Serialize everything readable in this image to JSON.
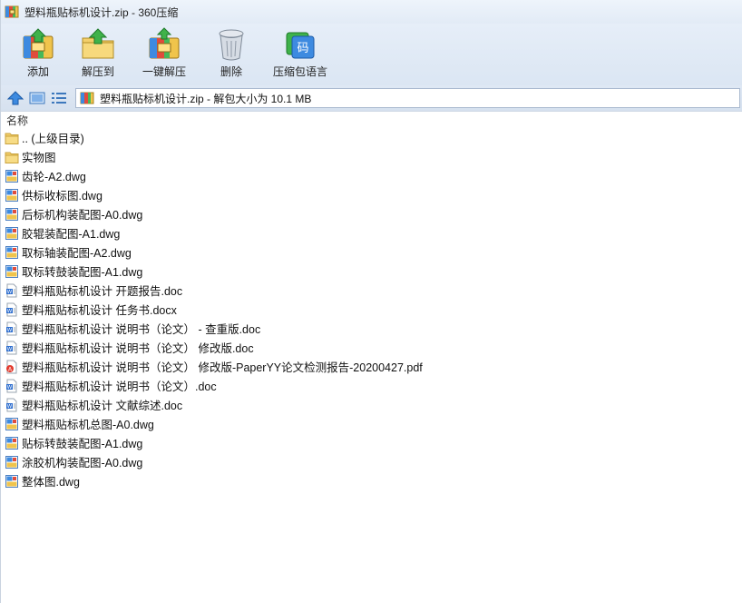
{
  "window": {
    "title": "塑料瓶贴标机设计.zip - 360压缩"
  },
  "toolbar": {
    "buttons": [
      {
        "label": "添加",
        "icon": "add-archive-icon"
      },
      {
        "label": "解压到",
        "icon": "extract-to-icon"
      },
      {
        "label": "一键解压",
        "icon": "one-click-extract-icon"
      },
      {
        "label": "删除",
        "icon": "trash-can-icon"
      },
      {
        "label": "压缩包语言",
        "icon": "language-code-icon",
        "badge": "码"
      }
    ]
  },
  "address": {
    "path": "塑料瓶贴标机设计.zip - 解包大小为 10.1 MB"
  },
  "list": {
    "header": "名称",
    "items": [
      {
        "name": ".. (上级目录)",
        "type": "folder"
      },
      {
        "name": "实物图",
        "type": "folder"
      },
      {
        "name": "齿轮-A2.dwg",
        "type": "dwg"
      },
      {
        "name": "供标收标图.dwg",
        "type": "dwg"
      },
      {
        "name": "后标机构装配图-A0.dwg",
        "type": "dwg"
      },
      {
        "name": "胶辊装配图-A1.dwg",
        "type": "dwg"
      },
      {
        "name": "取标轴装配图-A2.dwg",
        "type": "dwg"
      },
      {
        "name": "取标转鼓装配图-A1.dwg",
        "type": "dwg"
      },
      {
        "name": "塑料瓶贴标机设计 开题报告.doc",
        "type": "doc"
      },
      {
        "name": "塑料瓶贴标机设计 任务书.docx",
        "type": "docx"
      },
      {
        "name": "塑料瓶贴标机设计 说明书（论文） - 查重版.doc",
        "type": "doc"
      },
      {
        "name": "塑料瓶贴标机设计 说明书（论文） 修改版.doc",
        "type": "doc"
      },
      {
        "name": "塑料瓶贴标机设计 说明书（论文） 修改版-PaperYY论文检测报告-20200427.pdf",
        "type": "pdf"
      },
      {
        "name": "塑料瓶贴标机设计 说明书（论文）.doc",
        "type": "doc"
      },
      {
        "name": "塑料瓶贴标机设计 文献综述.doc",
        "type": "doc"
      },
      {
        "name": "塑料瓶贴标机总图-A0.dwg",
        "type": "dwg"
      },
      {
        "name": "贴标转鼓装配图-A1.dwg",
        "type": "dwg"
      },
      {
        "name": "涂胶机构装配图-A0.dwg",
        "type": "dwg"
      },
      {
        "name": "整体图.dwg",
        "type": "dwg"
      }
    ]
  },
  "colors": {
    "accent": "#2f7fd8",
    "folder": "#f3cf6a",
    "toolbar_bg": "#dbe6f3"
  }
}
